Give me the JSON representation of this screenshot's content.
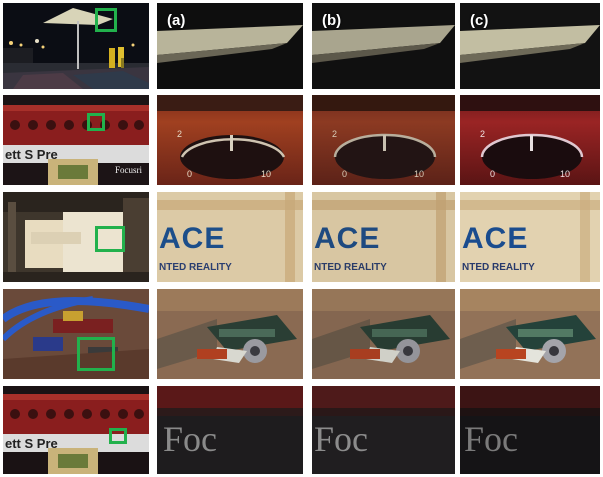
{
  "figure": {
    "column_labels": [
      "(a)",
      "(b)",
      "(c)"
    ],
    "rows": [
      {
        "scene": "night-street-umbrella",
        "crop_text": ""
      },
      {
        "scene": "audio-interface-knob",
        "context_text": "ett S Pre",
        "context_text_2": "Focusri",
        "dial_labels": [
          "2",
          "0",
          "10"
        ]
      },
      {
        "scene": "poster-ace",
        "crop_text": "ACE",
        "crop_subtext": "NTED REALITY"
      },
      {
        "scene": "toy-train",
        "crop_text": ""
      },
      {
        "scene": "audio-interface-logo",
        "context_text": "ett S Pre",
        "crop_text": "Foc"
      }
    ]
  },
  "colors": {
    "highlight_box": "#22b14c",
    "background": "#ffffff"
  }
}
